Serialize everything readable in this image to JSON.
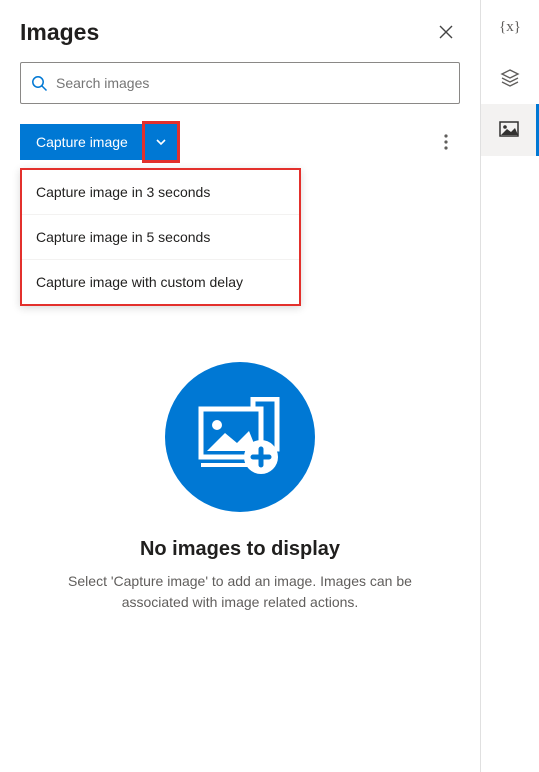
{
  "header": {
    "title": "Images"
  },
  "search": {
    "placeholder": "Search images"
  },
  "toolbar": {
    "capture_label": "Capture image"
  },
  "dropdown": {
    "items": [
      "Capture image in 3 seconds",
      "Capture image in 5 seconds",
      "Capture image with custom delay"
    ]
  },
  "empty": {
    "title": "No images to display",
    "desc": "Select 'Capture image' to add an image. Images can be associated with image related actions."
  }
}
